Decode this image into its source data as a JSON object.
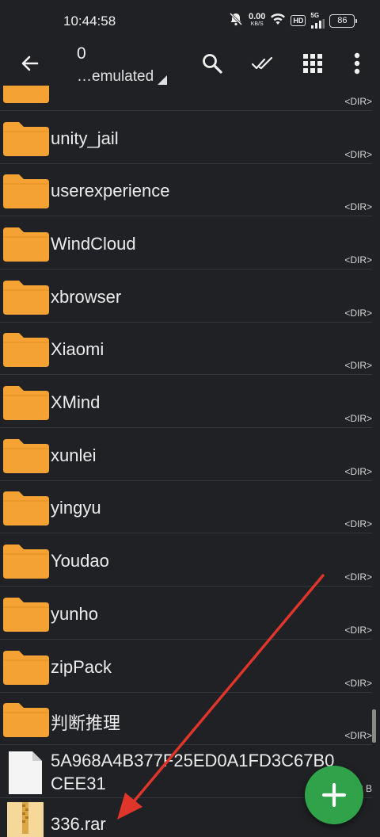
{
  "status_bar": {
    "time": "10:44:58",
    "net_speed_value": "0.00",
    "net_speed_unit": "KB/S",
    "hd_badge": "HD",
    "signal_badge": "5G",
    "battery": "86"
  },
  "toolbar": {
    "count": "0",
    "path": "…emulated",
    "icons": [
      "back-arrow-icon",
      "search-icon",
      "check-all-icon",
      "grid-view-icon",
      "more-vert-icon"
    ]
  },
  "colors": {
    "background": "#202124",
    "folder": "#f4a234",
    "fab": "#2fa24a",
    "arrow": "#e0352b"
  },
  "files": [
    {
      "name": "",
      "type": "folder",
      "meta": "<DIR>"
    },
    {
      "name": "unity_jail",
      "type": "folder",
      "meta": "<DIR>"
    },
    {
      "name": "userexperience",
      "type": "folder",
      "meta": "<DIR>"
    },
    {
      "name": "WindCloud",
      "type": "folder",
      "meta": "<DIR>"
    },
    {
      "name": "xbrowser",
      "type": "folder",
      "meta": "<DIR>"
    },
    {
      "name": "Xiaomi",
      "type": "folder",
      "meta": "<DIR>"
    },
    {
      "name": "XMind",
      "type": "folder",
      "meta": "<DIR>"
    },
    {
      "name": "xunlei",
      "type": "folder",
      "meta": "<DIR>"
    },
    {
      "name": "yingyu",
      "type": "folder",
      "meta": "<DIR>"
    },
    {
      "name": "Youdao",
      "type": "folder",
      "meta": "<DIR>"
    },
    {
      "name": "yunho",
      "type": "folder",
      "meta": "<DIR>"
    },
    {
      "name": "zipPack",
      "type": "folder",
      "meta": "<DIR>"
    },
    {
      "name": "判断推理",
      "type": "folder",
      "meta": "<DIR>"
    },
    {
      "name": "5A968A4B377F25ED0A1FD3C67B0CEE31",
      "line1": "5A968A4B377F25ED0A1FD3C67B0",
      "line2": "CEE31",
      "type": "file",
      "meta": "2 B"
    },
    {
      "name": "336.rar",
      "type": "archive",
      "meta": ""
    }
  ],
  "fab_icon": "plus-icon"
}
